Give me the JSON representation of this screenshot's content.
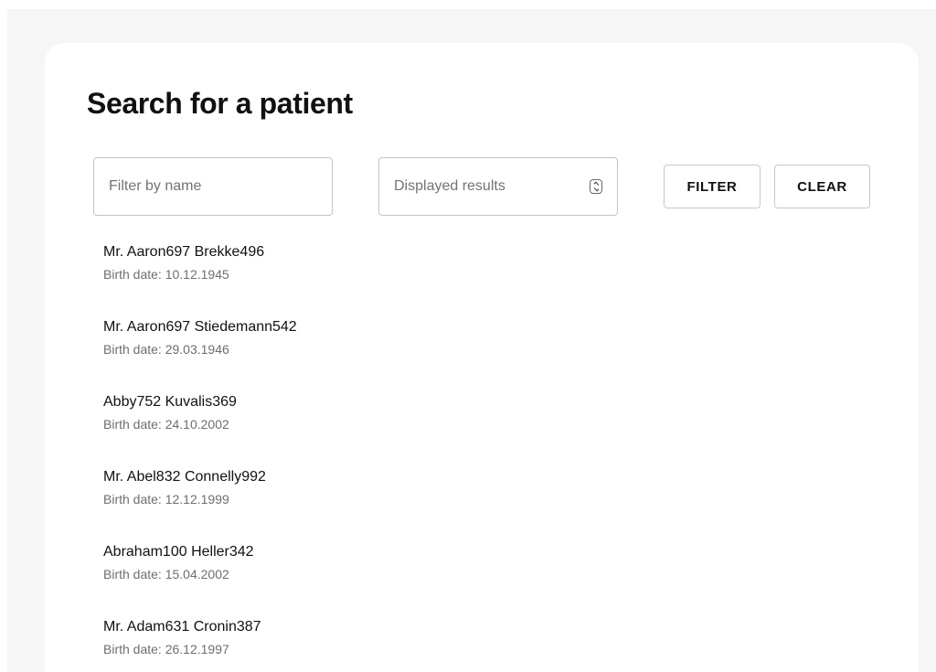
{
  "page": {
    "title": "Search for a patient"
  },
  "filters": {
    "name_placeholder": "Filter by name",
    "results_placeholder": "Displayed results",
    "filter_label": "FILTER",
    "clear_label": "CLEAR"
  },
  "patients": [
    {
      "name": "Mr. Aaron697 Brekke496",
      "birth": "Birth date: 10.12.1945"
    },
    {
      "name": "Mr. Aaron697 Stiedemann542",
      "birth": "Birth date: 29.03.1946"
    },
    {
      "name": "Abby752 Kuvalis369",
      "birth": "Birth date: 24.10.2002"
    },
    {
      "name": "Mr. Abel832 Connelly992",
      "birth": "Birth date: 12.12.1999"
    },
    {
      "name": "Abraham100 Heller342",
      "birth": "Birth date: 15.04.2002"
    },
    {
      "name": "Mr. Adam631 Cronin387",
      "birth": "Birth date: 26.12.1997"
    }
  ],
  "colors": {
    "page_background": "#f6f6f6",
    "card_background": "#ffffff",
    "border": "#c4c4c4",
    "secondary_text": "#6e6e6e"
  }
}
